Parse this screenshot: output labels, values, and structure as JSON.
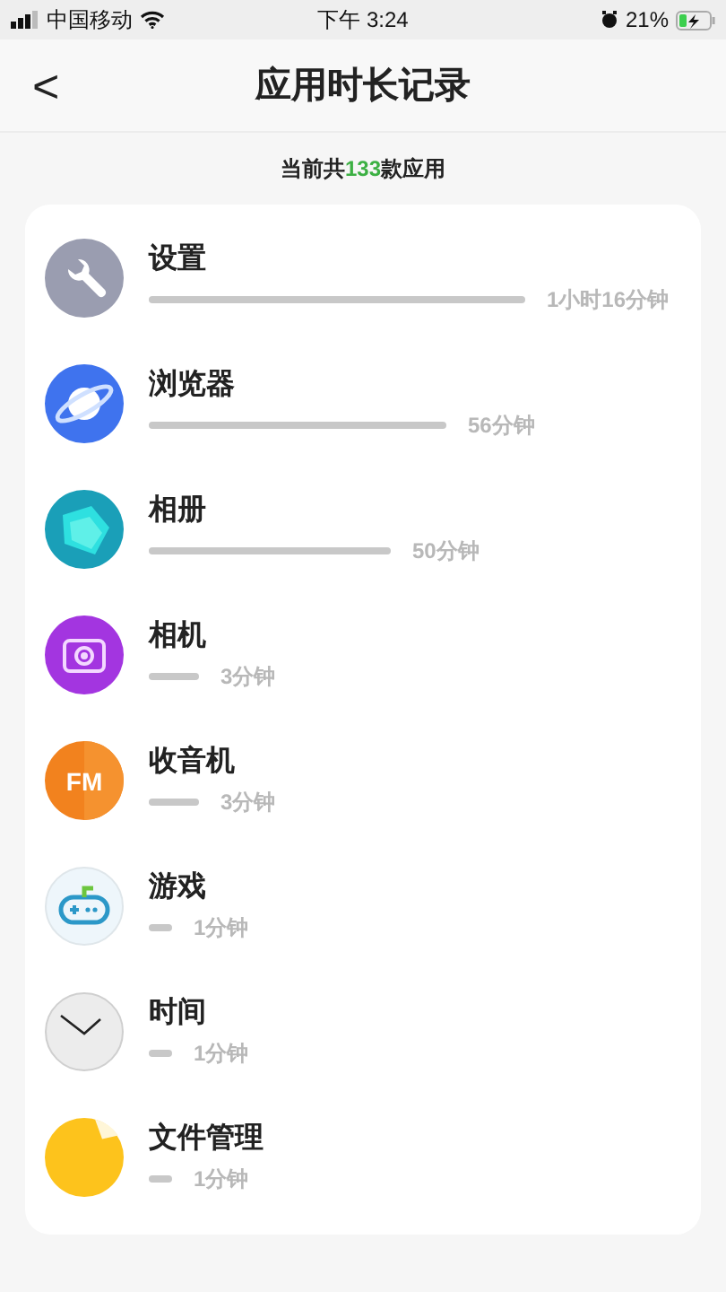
{
  "status_bar": {
    "carrier": "中国移动",
    "time": "下午 3:24",
    "battery": "21%",
    "charging": true
  },
  "header": {
    "back": "<",
    "title": "应用时长记录"
  },
  "summary": {
    "prefix": "当前共",
    "count": "133",
    "suffix": "款应用"
  },
  "apps": [
    {
      "kind": "settings",
      "name": "设置",
      "reading": "1小时16分钟"
    },
    {
      "kind": "browser",
      "name": "浏览器",
      "reading": "56分钟"
    },
    {
      "kind": "album",
      "name": "相册",
      "reading": "50分钟"
    },
    {
      "kind": "camera",
      "name": "相机",
      "reading": "3分钟"
    },
    {
      "kind": "radio",
      "icon_text": "FM",
      "name": "收音机",
      "reading": "3分钟"
    },
    {
      "kind": "game",
      "name": "游戏",
      "reading": "1分钟"
    },
    {
      "kind": "clock",
      "name": "时间",
      "reading": "1分钟"
    },
    {
      "kind": "files",
      "name": "文件管理",
      "reading": "1分钟"
    }
  ]
}
